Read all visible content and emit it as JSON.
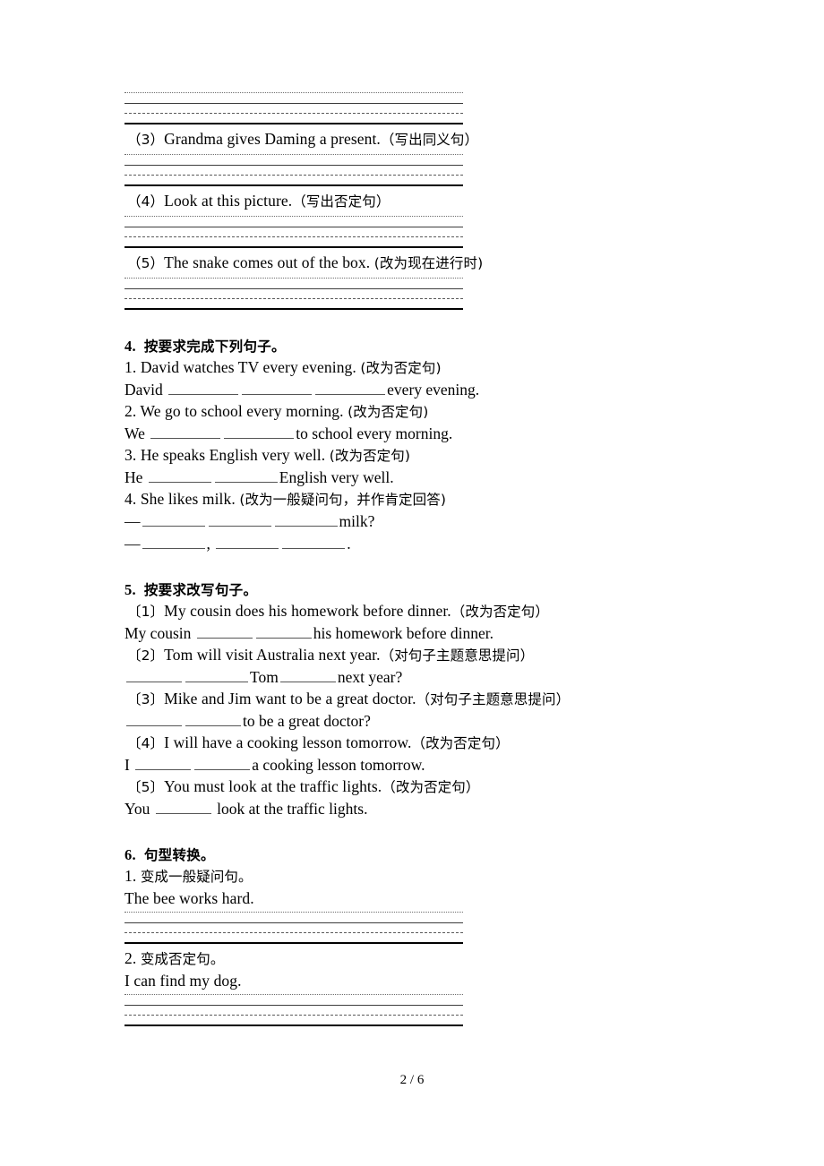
{
  "document": {
    "page_number": "2 / 6",
    "top_rule_group": {
      "lines": 4
    }
  },
  "items_top": [
    {
      "label": "（3）",
      "text": "Grandma gives Daming a present.",
      "instruction": "（写出同义句）",
      "rules": 4
    },
    {
      "label": "（4）",
      "text": "Look at this picture.",
      "instruction": "（写出否定句）",
      "rules": 4
    },
    {
      "label": "（5）",
      "text": "The snake comes out of the box.",
      "instruction": "(改为现在进行时)",
      "rules": 4
    }
  ],
  "section4": {
    "heading_num": "4.",
    "heading_title": "按要求完成下列句子。",
    "questions": [
      {
        "num": "1.",
        "text": "David watches TV every evening.",
        "instruction": "(改为否定句)",
        "answer_prefix": "David",
        "blanks": 3,
        "answer_suffix": "every evening."
      },
      {
        "num": "2.",
        "text": "We go to school every morning.",
        "instruction": "(改为否定句)",
        "answer_prefix": "We",
        "blanks": 2,
        "answer_suffix": "to school every morning."
      },
      {
        "num": "3.",
        "text": "He speaks English very well.",
        "instruction": "(改为否定句)",
        "answer_prefix": "He",
        "blanks": 2,
        "answer_suffix": "English very well."
      },
      {
        "num": "4.",
        "text": "She likes milk.",
        "instruction": "(改为一般疑问句，并作肯定回答)",
        "answer_prefix": "—",
        "blanks": 3,
        "answer_suffix": "milk?",
        "answer_line2_prefix": "—",
        "answer_line2_mid": ",",
        "answer_line2_end": "."
      }
    ]
  },
  "section5": {
    "heading_num": "5.",
    "heading_title": "按要求改写句子。",
    "questions": [
      {
        "label": "〔1〕",
        "text": "My cousin does his homework before dinner.",
        "instruction": "（改为否定句）",
        "answer_prefix": "My cousin",
        "answer_suffix": "his homework before dinner."
      },
      {
        "label": "〔2〕",
        "text": "Tom will visit Australia next year.",
        "instruction": "（对句子主题意思提问）",
        "answer_mid": "Tom",
        "answer_suffix": "next year?"
      },
      {
        "label": "〔3〕",
        "text": "Mike and Jim want to be a great doctor.",
        "instruction": "（对句子主题意思提问）",
        "answer_suffix": "to be a great doctor?"
      },
      {
        "label": "〔4〕",
        "text": "I will have a cooking lesson tomorrow.",
        "instruction": "（改为否定句）",
        "answer_prefix": "I",
        "answer_suffix": "a cooking lesson tomorrow."
      },
      {
        "label": "〔5〕",
        "text": "You must look at the traffic lights.",
        "instruction": "（改为否定句）",
        "answer_prefix": "You",
        "answer_suffix": "look at the traffic lights."
      }
    ]
  },
  "section6": {
    "heading_num": "6.",
    "heading_title": "句型转换。",
    "questions": [
      {
        "num": "1.",
        "instruction": "变成一般疑问句。",
        "sentence": "The bee works hard.",
        "rules": 4
      },
      {
        "num": "2.",
        "instruction": "变成否定句。",
        "sentence": "I can find my dog.",
        "rules": 4
      }
    ]
  }
}
